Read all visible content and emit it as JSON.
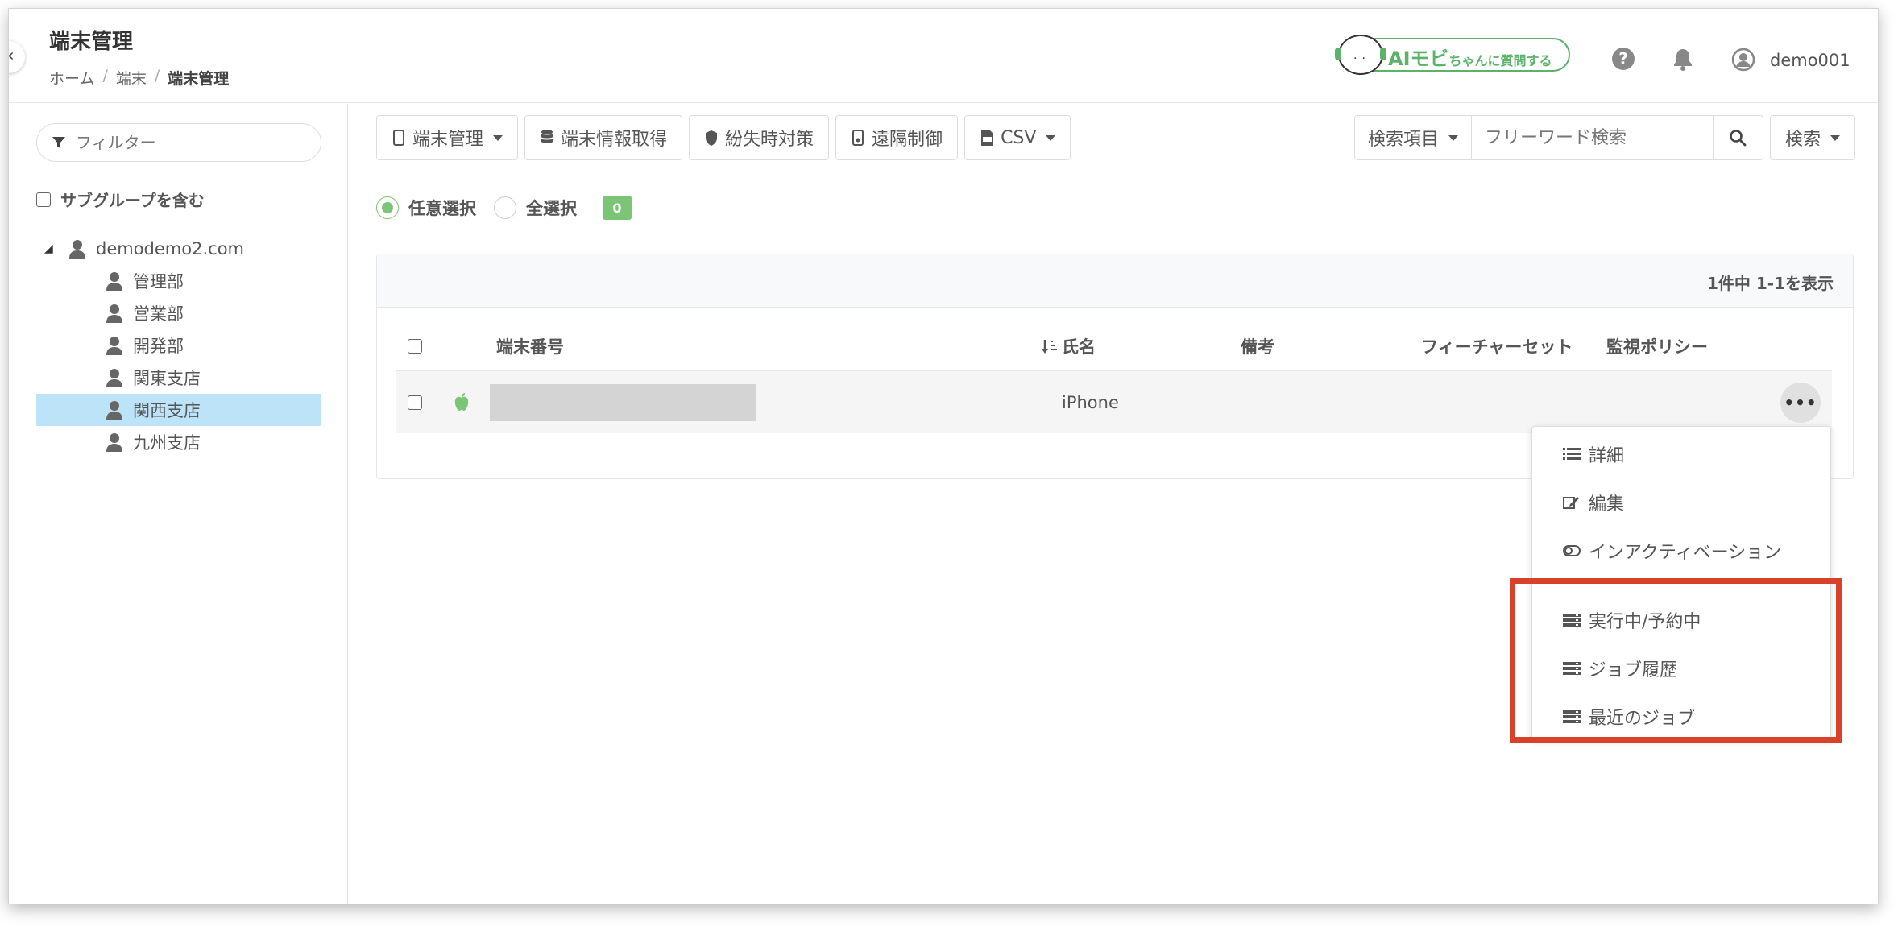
{
  "header": {
    "title": "端末管理",
    "breadcrumb": {
      "home": "ホーム",
      "sep1": "/",
      "device": "端末",
      "sep2": "/",
      "current": "端末管理"
    },
    "ai_badge": {
      "ai": "AIモビ",
      "chan": "ちゃん",
      "question": "に質問する"
    },
    "username": "demo001"
  },
  "sidebar": {
    "filter_placeholder": "フィルター",
    "include_subgroups": "サブグループを含む",
    "tree": {
      "root": "demodemo2.com",
      "children": [
        "管理部",
        "営業部",
        "開発部",
        "関東支店",
        "関西支店",
        "九州支店"
      ],
      "selected": "関西支店"
    }
  },
  "toolbar": {
    "device_mgmt": "端末管理",
    "get_info": "端末情報取得",
    "lost_measures": "紛失時対策",
    "remote_control": "遠隔制御",
    "csv": "CSV"
  },
  "search": {
    "field_select": "検索項目",
    "placeholder": "フリーワード検索",
    "search_dropdown": "検索"
  },
  "selection": {
    "arbitrary": "任意選択",
    "all": "全選択",
    "count": "0"
  },
  "table": {
    "showing": "1件中 1-1を表示",
    "columns": {
      "device_number": "端末番号",
      "name": "氏名",
      "note": "備考",
      "feature_set": "フィーチャーセット",
      "policy": "監視ポリシー"
    },
    "rows": [
      {
        "name": "iPhone",
        "more": "•••"
      }
    ]
  },
  "context_menu": {
    "items": [
      "詳細",
      "編集",
      "インアクティベーション",
      "実行中/予約中",
      "ジョブ履歴",
      "最近のジョブ"
    ]
  },
  "colors": {
    "accent_green": "#7cc576",
    "selected_bg": "#bde3f8",
    "highlight_red": "#d9412b"
  }
}
